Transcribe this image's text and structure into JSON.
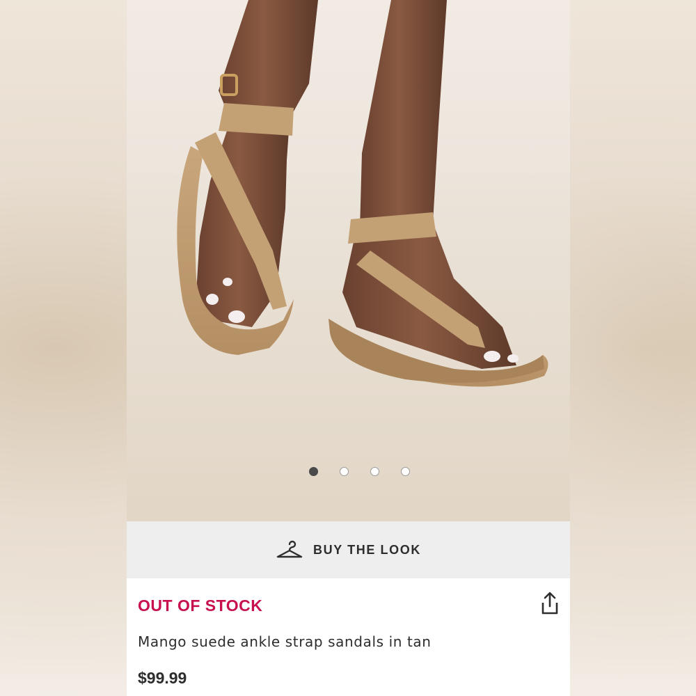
{
  "gallery": {
    "image_alt": "Model wearing tan suede ankle strap thong sandals",
    "dots": [
      {
        "active": true
      },
      {
        "active": false
      },
      {
        "active": false
      },
      {
        "active": false
      }
    ]
  },
  "buy_the_look": {
    "icon": "hanger-icon",
    "label": "BUY THE LOOK"
  },
  "product": {
    "stock_status": "OUT OF STOCK",
    "stock_color": "#c8104f",
    "name": "Mango suede ankle strap sandals in tan",
    "price": "$99.99",
    "share_icon": "share-icon"
  }
}
